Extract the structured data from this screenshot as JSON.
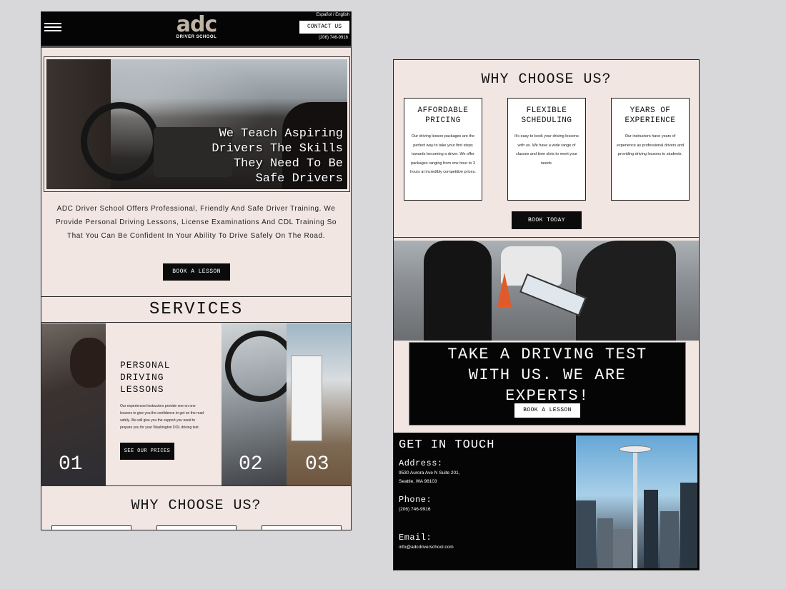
{
  "header": {
    "logo_mark": "adc",
    "logo_sub": "DRIVER SCHOOL",
    "lang": "Español / English",
    "contact_button": "CONTACT US",
    "phone": "(206) 746-9916"
  },
  "hero": {
    "headline_lines": [
      "We Teach Aspiring",
      "Drivers The Skills",
      "They Need To Be",
      "Safe Drivers"
    ]
  },
  "intro": {
    "text": "ADC Driver School Offers Professional, Friendly And Safe Driver Training. We Provide Personal Driving Lessons, License Examinations And CDL Training So That You Can Be Confident In Your Ability To Drive Safely On The Road.",
    "button": "BOOK A LESSON"
  },
  "services": {
    "title": "SERVICES",
    "card_title_lines": [
      "PERSONAL",
      "DRIVING",
      "LESSONS"
    ],
    "card_text": "Our experienced instructors provide one on one lessons to give you the confidence to get on the road safely. We will give you the support you need to prepare you for your Washington DOL driving test.",
    "card_button": "SEE OUR PRICES",
    "numbers": [
      "01",
      "02",
      "03"
    ]
  },
  "why": {
    "title": "WHY CHOOSE US?",
    "cards": [
      {
        "title_lines": [
          "AFFORDABLE",
          "PRICING"
        ],
        "text": "Our driving lesson packages are the perfect way to take your first steps towards becoming a driver. We offer packages ranging from one hour to 3 hours at incredibly competitive prices."
      },
      {
        "title_lines": [
          "FLEXIBLE",
          "SCHEDULING"
        ],
        "text": "It's easy to book your driving lessons with us. We have a wide range of classes and time slots to meet your needs."
      },
      {
        "title_lines": [
          "YEARS OF",
          "EXPERIENCE"
        ],
        "text": "Our instructors have years of experience as professional drivers and providing driving lessons to students."
      }
    ],
    "button": "BOOK TODAY"
  },
  "test": {
    "headline_lines": [
      "TAKE A DRIVING TEST",
      "WITH US. WE ARE",
      "EXPERTS!"
    ],
    "button": "BOOK A LESSON"
  },
  "contact": {
    "title": "GET IN TOUCH",
    "address_label": "Address:",
    "address_lines": [
      "9530 Aurora Ave N Suite 201,",
      "Seattle, WA 98103"
    ],
    "phone_label": "Phone:",
    "phone": "(206) 746-9916",
    "email_label": "Email:",
    "email": "info@adcdriverschool.com"
  },
  "colors": {
    "background": "#d8d7d9",
    "page": "#f1e6e2",
    "dark": "#050505",
    "logo": "#bfb3a6"
  }
}
